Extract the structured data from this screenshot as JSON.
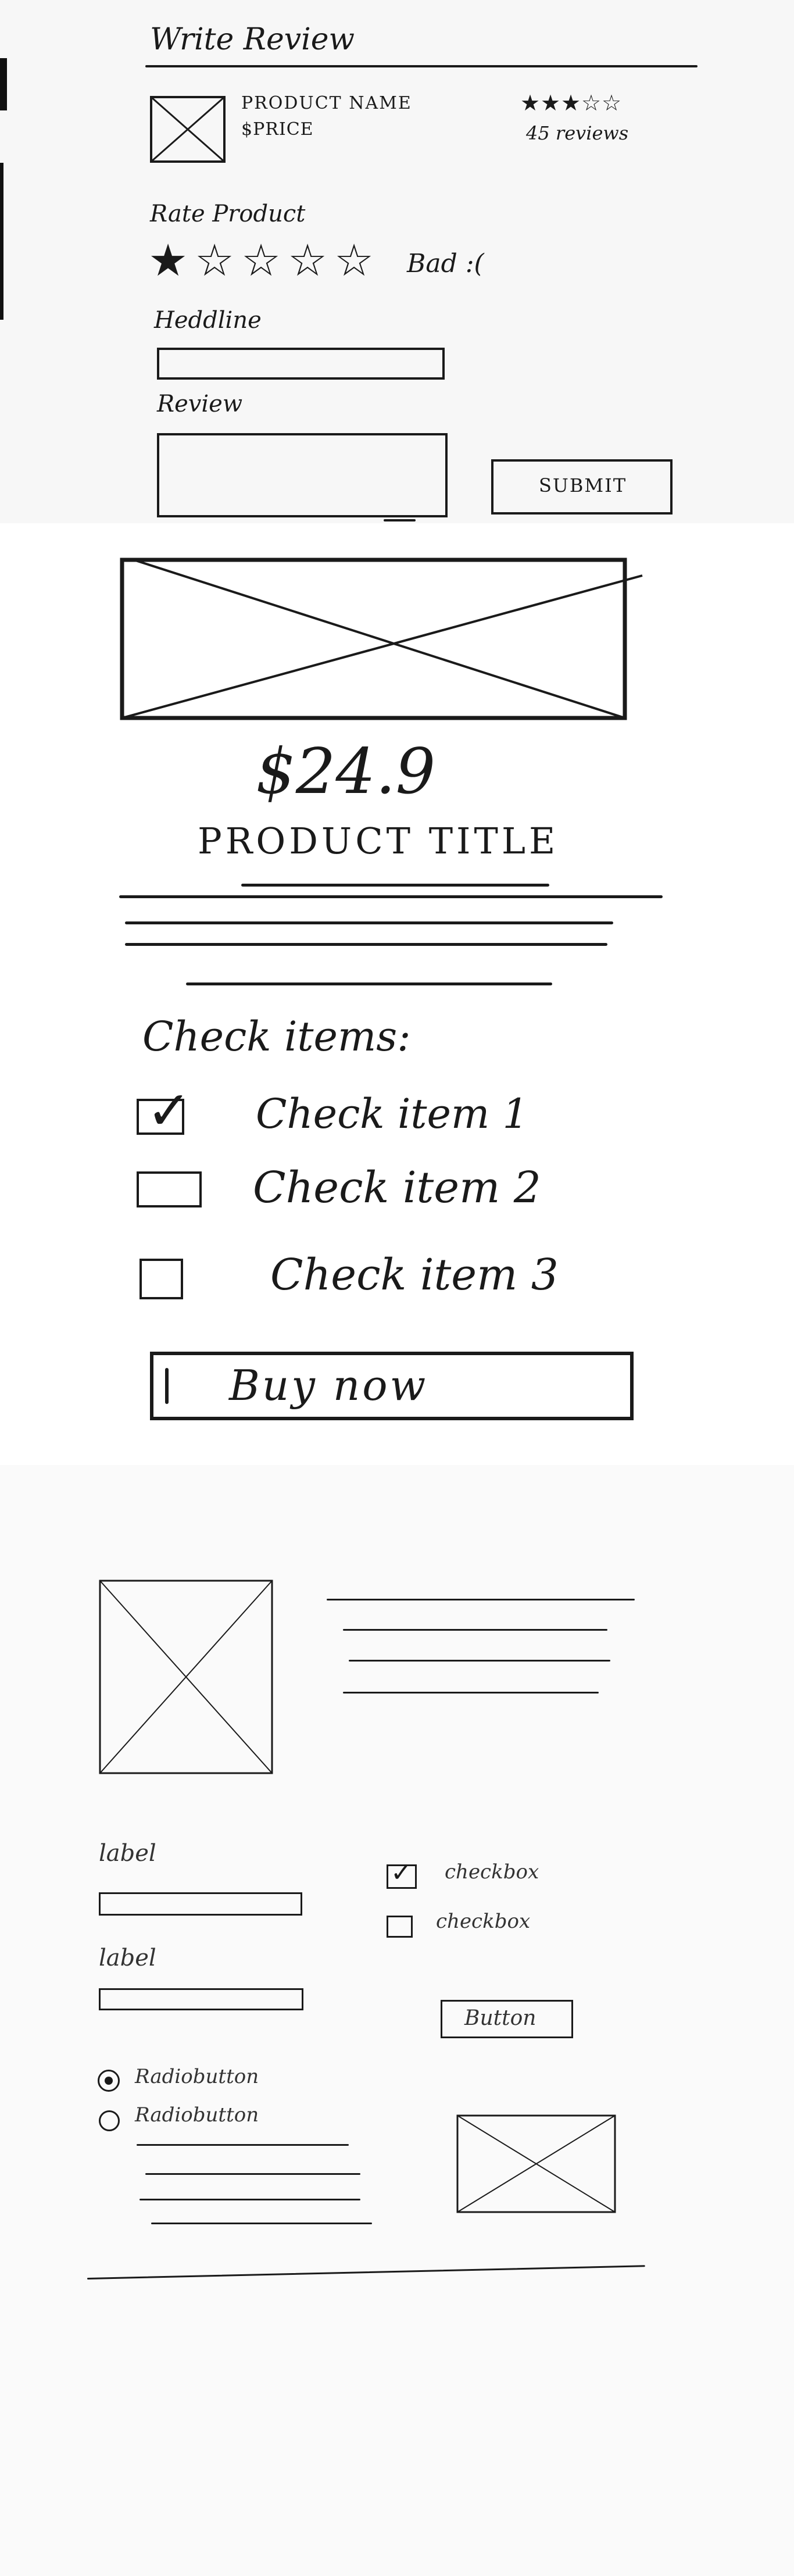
{
  "review_form": {
    "title": "Write Review",
    "product_name": "PRODUCT NAME",
    "price": "$PRICE",
    "rating_stars": 3,
    "rating_out_of": 5,
    "reviews_count": "45 reviews",
    "rate_label": "Rate Product",
    "selected_rating": 1,
    "rating_feedback": "Bad :(",
    "headline_label": "Heddline",
    "review_label": "Review",
    "submit_label": "SUBMIT"
  },
  "product_detail": {
    "price": "$24.9",
    "title": "PRODUCT TITLE",
    "check_heading": "Check items:",
    "check_items": [
      {
        "label": "Check item 1",
        "checked": true
      },
      {
        "label": "Check item 2",
        "checked": false
      },
      {
        "label": "Check item 3",
        "checked": false
      }
    ],
    "buy_label": "Buy now"
  },
  "component_sheet": {
    "field_label_1": "label",
    "field_label_2": "label",
    "checkbox_1": {
      "label": "checkbox",
      "checked": true
    },
    "checkbox_2": {
      "label": "checkbox",
      "checked": false
    },
    "button_label": "Button",
    "radio_1": {
      "label": "Radiobutton",
      "selected": true
    },
    "radio_2": {
      "label": "Radiobutton",
      "selected": false
    }
  },
  "icons": {
    "filled_star": "star-filled-icon",
    "empty_star": "star-outline-icon",
    "image_placeholder": "image-placeholder-icon",
    "check": "checkmark-icon"
  }
}
